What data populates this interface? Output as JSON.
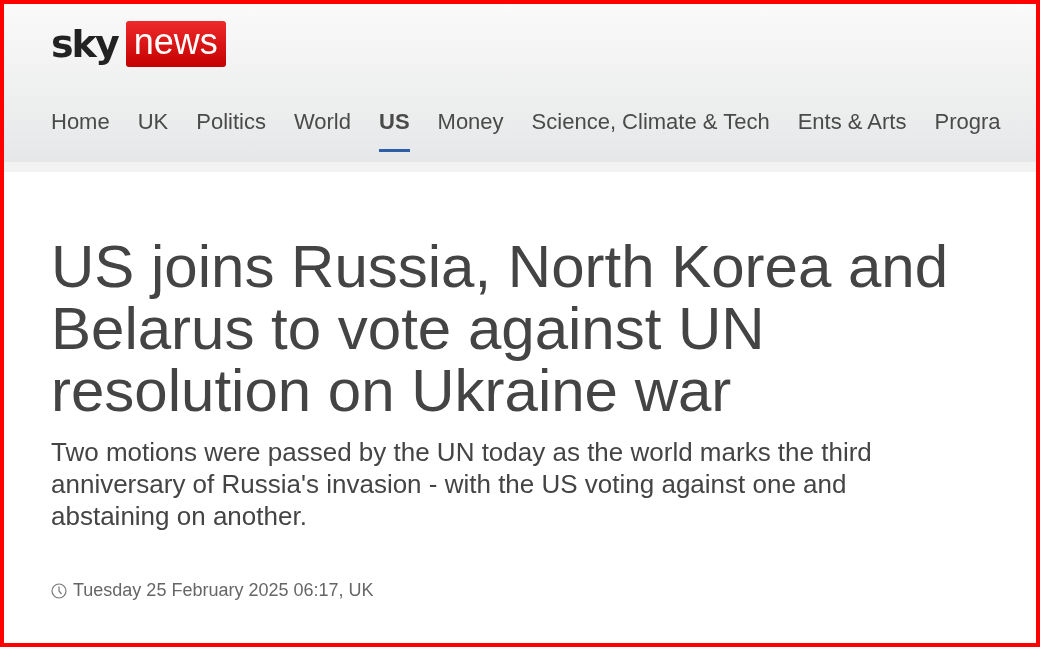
{
  "logo": {
    "brand": "sky",
    "product": "news"
  },
  "nav": [
    {
      "label": "Home",
      "selected": false
    },
    {
      "label": "UK",
      "selected": false
    },
    {
      "label": "Politics",
      "selected": false
    },
    {
      "label": "World",
      "selected": false
    },
    {
      "label": "US",
      "selected": true
    },
    {
      "label": "Money",
      "selected": false
    },
    {
      "label": "Science, Climate & Tech",
      "selected": false
    },
    {
      "label": "Ents & Arts",
      "selected": false
    },
    {
      "label": "Progra",
      "selected": false
    }
  ],
  "article": {
    "headline": "US joins Russia, North Korea and Belarus to vote against UN resolution on Ukraine war",
    "standfirst": "Two motions were passed by the UN today as the world marks the third anniversary of Russia's invasion - with the US voting against one and abstaining on another.",
    "date": "Tuesday 25 February 2025 06:17, UK"
  }
}
